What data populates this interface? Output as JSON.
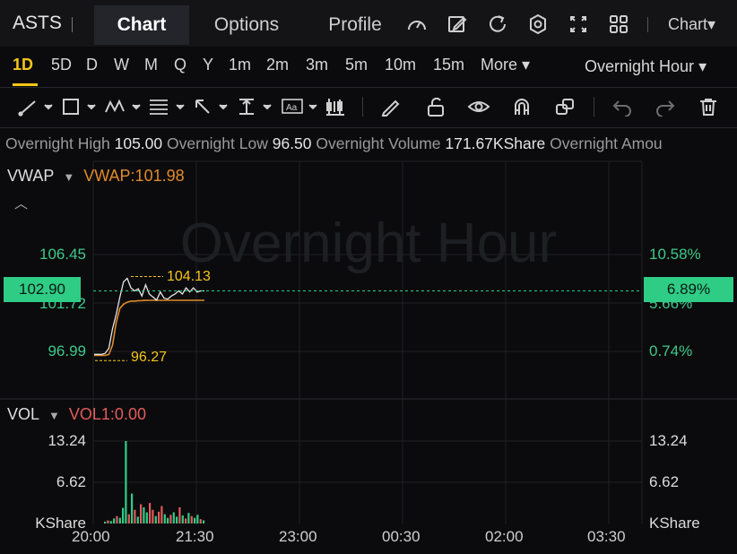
{
  "header": {
    "ticker": "ASTS",
    "tabs": [
      {
        "label": "Chart",
        "active": true
      },
      {
        "label": "Options"
      },
      {
        "label": "Profile"
      }
    ],
    "chart_menu": "Chart",
    "icons": [
      "gauge-icon",
      "edit-icon",
      "refresh-icon",
      "settings-icon",
      "fullscreen-icon",
      "grid-layout-icon"
    ]
  },
  "periods": {
    "items": [
      "1D",
      "5D",
      "D",
      "W",
      "M",
      "Q",
      "Y",
      "1m",
      "2m",
      "3m",
      "5m",
      "10m",
      "15m",
      "More"
    ],
    "active": "1D",
    "session": "Overnight Hour"
  },
  "stats": {
    "high_label": "Overnight High",
    "high": "105.00",
    "low_label": "Overnight Low",
    "low": "96.50",
    "volume_label": "Overnight Volume",
    "volume": "171.67KShare",
    "amount_label": "Overnight Amou"
  },
  "main": {
    "indicator": "VWAP",
    "indicator_value": "VWAP:101.98",
    "watermark": "Overnight Hour",
    "left_ticks": [
      "106.45",
      "101.72",
      "96.99"
    ],
    "right_ticks": [
      "10.58%",
      "5.66%",
      "0.74%"
    ],
    "current_price": "102.90",
    "current_pct": "6.89%",
    "high_annot": "104.13",
    "low_annot": "96.27"
  },
  "volume": {
    "indicator": "VOL",
    "indicator_value": "VOL1:0.00",
    "ticks": [
      "13.24",
      "6.62",
      "KShare"
    ]
  },
  "x_labels": [
    "20:00",
    "21:30",
    "23:00",
    "00:30",
    "02:00",
    "03:30"
  ],
  "colors": {
    "accent": "#f5c518",
    "up": "#2fcc86",
    "down": "#e25b5b",
    "vwap": "#e08a2a"
  },
  "chart_data": {
    "type": "line",
    "x_start": "20:00",
    "x_end": "21:35",
    "price": [
      96.7,
      96.7,
      96.7,
      96.8,
      97.3,
      99.2,
      100.6,
      102.3,
      103.8,
      104.13,
      103.2,
      102.9,
      103.1,
      102.4,
      103.5,
      102.6,
      102.3,
      102.0,
      102.8,
      102.2,
      102.1,
      102.4,
      102.6,
      102.9,
      102.6,
      103.2,
      102.8,
      103.2,
      102.8,
      102.9,
      102.9
    ],
    "vwap": [
      96.6,
      96.6,
      96.6,
      96.6,
      96.7,
      97.6,
      99.8,
      101.2,
      101.6,
      101.8,
      101.9,
      101.9,
      101.95,
      101.96,
      101.97,
      101.98,
      101.98,
      101.98,
      101.98,
      101.98,
      101.98,
      101.98,
      101.98,
      101.98,
      101.98,
      101.98,
      101.98,
      101.98,
      101.98,
      101.98,
      101.98
    ],
    "vol_ylim": [
      0,
      15
    ],
    "volume": [
      0.3,
      0.5,
      0.4,
      0.8,
      1.2,
      0.9,
      2.5,
      13.24,
      1.5,
      4.8,
      2.2,
      1.1,
      3.1,
      2.6,
      1.8,
      3.3,
      2.2,
      1.2,
      1.9,
      2.8,
      1.5,
      0.9,
      1.4,
      1.8,
      1.1,
      2.6,
      1.3,
      0.8,
      1.7,
      1.2,
      0.9,
      1.4,
      0.7,
      0.5
    ],
    "volume_up": [
      true,
      false,
      true,
      true,
      false,
      true,
      true,
      true,
      false,
      true,
      false,
      true,
      false,
      true,
      true,
      false,
      false,
      true,
      false,
      false,
      true,
      true,
      false,
      true,
      true,
      false,
      true,
      false,
      true,
      false,
      true,
      true,
      false,
      true
    ],
    "ylim": [
      94.61,
      108.82
    ]
  }
}
